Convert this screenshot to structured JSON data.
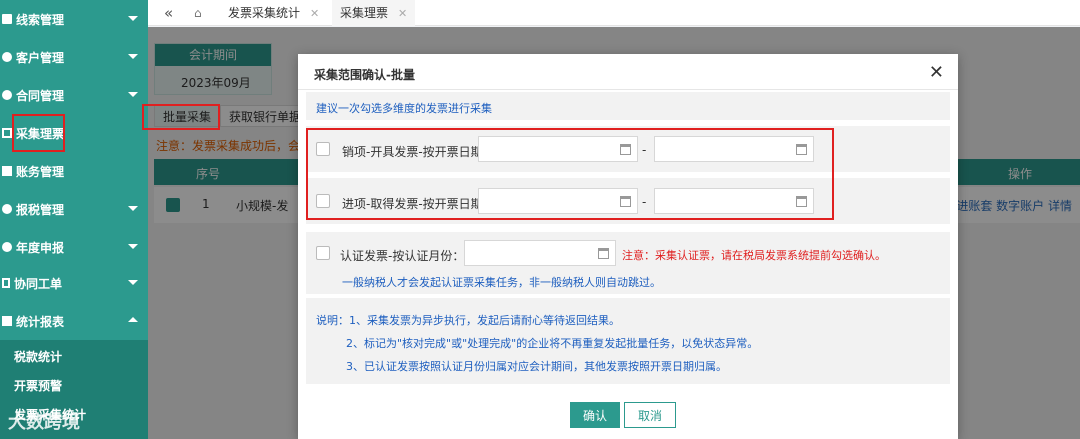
{
  "sidebar": {
    "items": [
      {
        "label": "线索管理",
        "icon": "clipboard-icon"
      },
      {
        "label": "客户管理",
        "icon": "user-icon"
      },
      {
        "label": "合同管理",
        "icon": "contract-icon"
      },
      {
        "label": "采集理票",
        "icon": "collect-icon"
      },
      {
        "label": "账务管理",
        "icon": "ledger-icon"
      },
      {
        "label": "报税管理",
        "icon": "tax-icon"
      },
      {
        "label": "年度申报",
        "icon": "annual-icon"
      },
      {
        "label": "协同工单",
        "icon": "workorder-icon"
      },
      {
        "label": "统计报表",
        "icon": "report-icon"
      }
    ],
    "sub_items": [
      "税款统计",
      "开票预警",
      "发票采集统计"
    ]
  },
  "tabs": {
    "home_icon": "home-icon",
    "items": [
      {
        "label": "发票采集统计"
      },
      {
        "label": "采集理票"
      }
    ]
  },
  "background": {
    "period_label": "会计期间",
    "period_value": "2023年09月",
    "batch_collect": "批量采集",
    "fetch_bank": "获取银行单据",
    "notice": "注意：发票采集成功后，会",
    "col_seq": "序号",
    "col_action": "操作",
    "row_seq": "1",
    "row_name": "小规模-发",
    "row_actions": "票 进账套 数字账户 详情"
  },
  "modal": {
    "title": "采集范围确认-批量",
    "hint": "建议一次勾选多维度的发票进行采集",
    "rows": [
      {
        "label": "销项-开具发票-按开票日期：",
        "dash": "-"
      },
      {
        "label": "进项-取得发票-按开票日期：",
        "dash": "-"
      }
    ],
    "cert": {
      "label": "认证发票-按认证月份：",
      "warning": "注意：采集认证票，请在税局发票系统提前勾选确认。",
      "note": "一般纳税人才会发起认证票采集任务，非一般纳税人则自动跳过。"
    },
    "notes": {
      "line1": "说明：1、采集发票为异步执行，发起后请耐心等待返回结果。",
      "line2": "2、标记为\"核对完成\"或\"处理完成\"的企业将不再重复发起批量任务，以免状态异常。",
      "line3": "3、已认证发票按照认证月份归属对应会计期间，其他发票按照开票日期归属。"
    },
    "confirm": "确认",
    "cancel": "取消"
  },
  "watermark": "大数跨境"
}
